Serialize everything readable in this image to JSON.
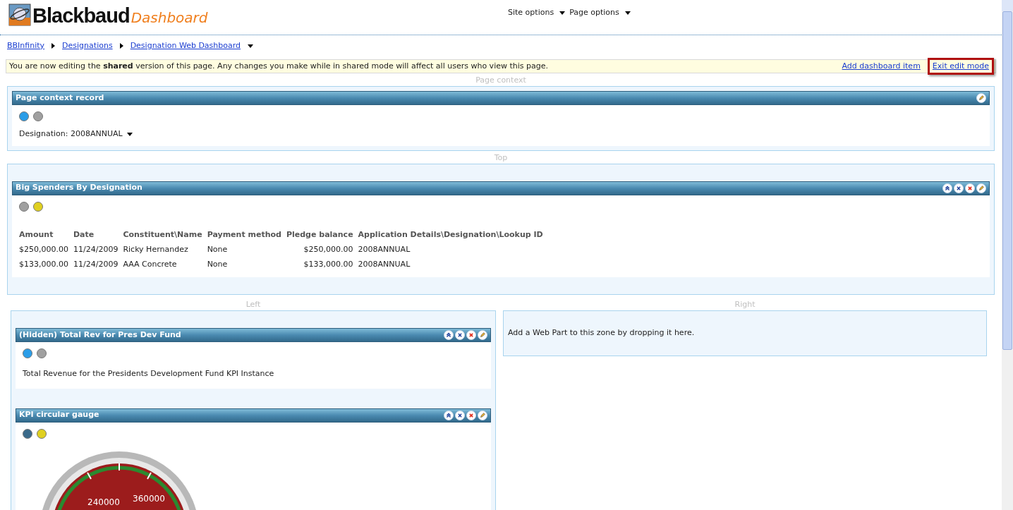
{
  "header": {
    "logo_text": "Blackbaud",
    "logo_suffix": "Dashboard",
    "menus": [
      "Site options",
      "Page options"
    ]
  },
  "breadcrumb": [
    "BBInfinity",
    "Designations",
    "Designation Web Dashboard"
  ],
  "edit_bar": {
    "message": "You are now editing the **shared** version of this page. Any changes you make while in shared mode will affect all users who view this page.",
    "links": [
      {
        "label": "Add dashboard item",
        "highlighted": false
      },
      {
        "label": "Exit edit mode",
        "highlighted": true
      }
    ]
  },
  "zones": [
    {
      "label": "Page context",
      "parts": [
        {
          "title": "Page context record",
          "tools": [
            {
              "kind": "edit"
            }
          ],
          "dots": [
            {
              "color": "#2a9de8"
            },
            {
              "color": "#a0a0a0"
            }
          ],
          "body": {
            "kind": "selector",
            "label": "Designation: 2008ANNUAL"
          }
        }
      ]
    },
    {
      "label": "Top",
      "parts": [
        {
          "title": "Big Spenders By Designation",
          "tools": [
            {
              "kind": "collapse"
            },
            {
              "kind": "minimize"
            },
            {
              "kind": "close"
            },
            {
              "kind": "edit"
            }
          ],
          "dots": [
            {
              "color": "#a0a0a0"
            },
            {
              "color": "#e0d020"
            }
          ],
          "body": {
            "kind": "table",
            "columns": [
              "Amount",
              "Date",
              "Constituent\\Name",
              "Payment method",
              "Pledge balance",
              "Application Details\\Designation\\Lookup ID"
            ],
            "rows": [
              [
                "$250,000.00",
                "11/24/2009",
                "Ricky Hernandez",
                "None",
                "$250,000.00",
                "2008ANNUAL"
              ],
              [
                "$133,000.00",
                "11/24/2009",
                "AAA Concrete",
                "None",
                "$133,000.00",
                "2008ANNUAL"
              ]
            ]
          }
        }
      ]
    }
  ],
  "columns": [
    {
      "label": "Left",
      "parts": [
        {
          "title": "(Hidden) Total Rev for Pres Dev Fund",
          "tools": [
            {
              "kind": "collapse"
            },
            {
              "kind": "minimize"
            },
            {
              "kind": "close"
            },
            {
              "kind": "edit"
            }
          ],
          "dots": [
            {
              "color": "#2a9de8"
            },
            {
              "color": "#a0a0a0"
            }
          ],
          "body": {
            "kind": "text",
            "text": "Total Revenue for the Presidents Development Fund KPI Instance"
          }
        },
        {
          "title": "KPI circular gauge",
          "tools": [
            {
              "kind": "collapse"
            },
            {
              "kind": "minimize"
            },
            {
              "kind": "close"
            },
            {
              "kind": "edit"
            }
          ],
          "dots": [
            {
              "color": "#3a6a8a"
            },
            {
              "color": "#e0d020"
            }
          ],
          "body": {
            "kind": "gauge",
            "labels": [
              "240000",
              "360000"
            ]
          }
        }
      ]
    },
    {
      "label": "Right",
      "empty_text": "Add a Web Part to this zone by dropping it here."
    }
  ]
}
